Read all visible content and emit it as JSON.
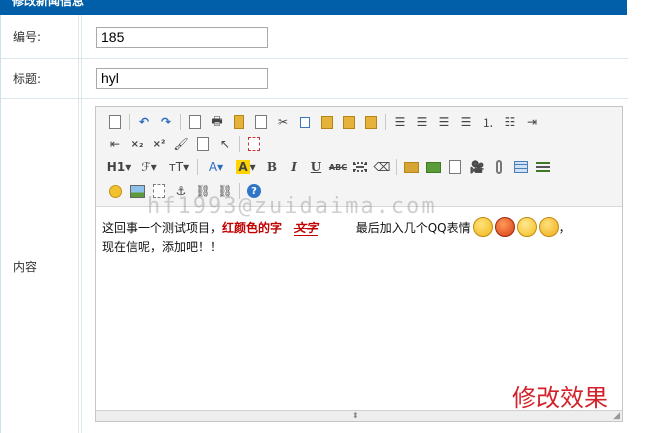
{
  "header": {
    "title": "修改新闻信息"
  },
  "form": {
    "number_label": "编号:",
    "number_value": "185",
    "title_label": "标题:",
    "title_value": "hyl",
    "content_label": "内容"
  },
  "editor": {
    "toolbar": {
      "row2": {
        "heading": "H1",
        "font_family": "ℱ",
        "font_size": "тT",
        "font_color": "A",
        "highlight": "A",
        "bold": "B",
        "italic": "I",
        "underline": "U",
        "strike": "ABC"
      }
    },
    "content": {
      "text_before": "这回事一个测试项目，",
      "red_text": "红颜色的字",
      "strike_text": "文字",
      "text_after": "最后加入几个QQ表情",
      "trailing": "，",
      "line2": "现在信呢，添加吧！！"
    }
  },
  "watermark": "hf1993@zuidaima.com",
  "caption": "修改效果"
}
